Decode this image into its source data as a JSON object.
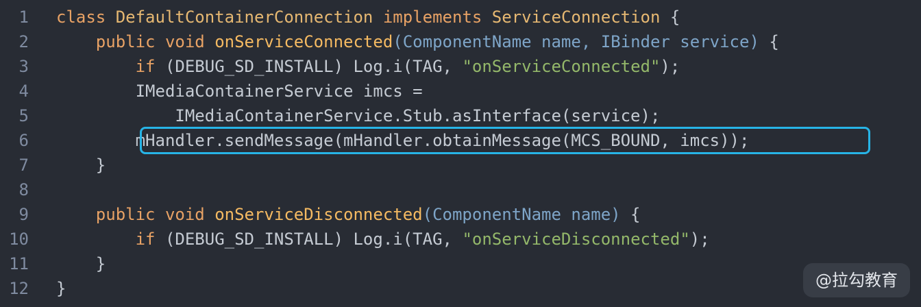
{
  "code": {
    "lines": [
      {
        "number": "1",
        "tokens": [
          {
            "t": "class ",
            "c": "kw"
          },
          {
            "t": "DefaultContainerConnection",
            "c": "cls"
          },
          {
            "t": " ",
            "c": "pl"
          },
          {
            "t": "implements",
            "c": "kw"
          },
          {
            "t": " ",
            "c": "pl"
          },
          {
            "t": "ServiceConnection",
            "c": "cls"
          },
          {
            "t": " {",
            "c": "pl"
          }
        ]
      },
      {
        "number": "2",
        "tokens": [
          {
            "t": "    ",
            "c": "pl"
          },
          {
            "t": "public void ",
            "c": "kw"
          },
          {
            "t": "onServiceConnected",
            "c": "fn"
          },
          {
            "t": "(ComponentName name, IBinder service)",
            "c": "par"
          },
          {
            "t": " {",
            "c": "pl"
          }
        ]
      },
      {
        "number": "3",
        "tokens": [
          {
            "t": "        ",
            "c": "pl"
          },
          {
            "t": "if",
            "c": "kw"
          },
          {
            "t": " (DEBUG_SD_INSTALL) Log.i(TAG, ",
            "c": "pl"
          },
          {
            "t": "\"onServiceConnected\"",
            "c": "str"
          },
          {
            "t": ");",
            "c": "pl"
          }
        ]
      },
      {
        "number": "4",
        "tokens": [
          {
            "t": "        IMediaContainerService imcs =",
            "c": "pl"
          }
        ]
      },
      {
        "number": "5",
        "tokens": [
          {
            "t": "            IMediaContainerService.Stub.asInterface(service);",
            "c": "pl"
          }
        ]
      },
      {
        "number": "6",
        "tokens": [
          {
            "t": "        mHandler.sendMessage(mHandler.obtainMessage(MCS_BOUND, imcs));",
            "c": "pl"
          }
        ]
      },
      {
        "number": "7",
        "tokens": [
          {
            "t": "    }",
            "c": "pl"
          }
        ]
      },
      {
        "number": "8",
        "tokens": []
      },
      {
        "number": "9",
        "tokens": [
          {
            "t": "    ",
            "c": "pl"
          },
          {
            "t": "public void ",
            "c": "kw"
          },
          {
            "t": "onServiceDisconnected",
            "c": "fn"
          },
          {
            "t": "(ComponentName name)",
            "c": "par"
          },
          {
            "t": " {",
            "c": "pl"
          }
        ]
      },
      {
        "number": "10",
        "tokens": [
          {
            "t": "        ",
            "c": "pl"
          },
          {
            "t": "if",
            "c": "kw"
          },
          {
            "t": " (DEBUG_SD_INSTALL) Log.i(TAG, ",
            "c": "pl"
          },
          {
            "t": "\"onServiceDisconnected\"",
            "c": "str"
          },
          {
            "t": ");",
            "c": "pl"
          }
        ]
      },
      {
        "number": "11",
        "tokens": [
          {
            "t": "    }",
            "c": "pl"
          }
        ]
      },
      {
        "number": "12",
        "tokens": [
          {
            "t": "}",
            "c": "pl"
          }
        ]
      }
    ],
    "highlighted_line": "6"
  },
  "watermark": {
    "text": "@拉勾教育"
  },
  "colors": {
    "background": "#282c34",
    "keyword": "#e8a265",
    "function": "#f5ba62",
    "class_name": "#e6b872",
    "params": "#7ea5c8",
    "string": "#94b86a",
    "plain": "#c5cbd3",
    "line_number": "#7f8ba0",
    "highlight_border": "#27b4e6"
  }
}
